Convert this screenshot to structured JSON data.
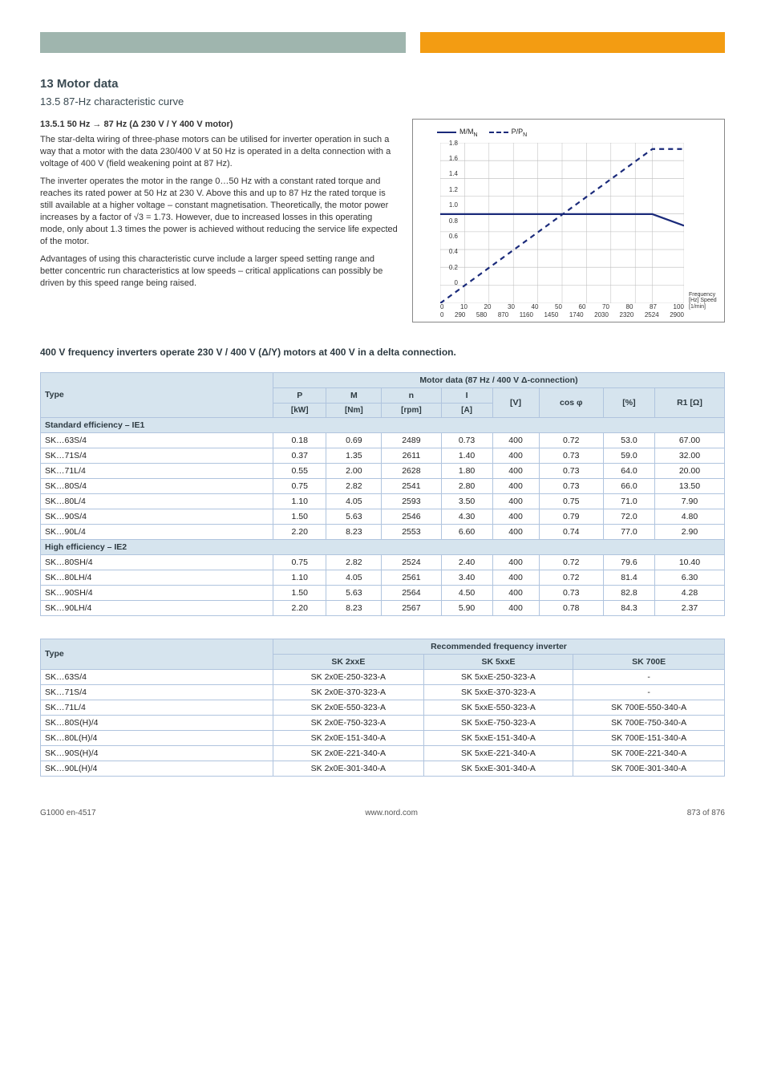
{
  "header": {
    "h1": "13 Motor data",
    "h2": "13.5 87-Hz characteristic curve"
  },
  "intro": {
    "subhead": "13.5.1 50 Hz → 87 Hz (Δ 230 V / Y 400 V motor)",
    "para1": "The star-delta wiring of three-phase motors can be utilised for inverter operation in such a way that a motor with the data 230/400 V at 50 Hz is operated in a delta connection with a voltage of 400 V (field weakening point at 87 Hz).",
    "para2": "The inverter operates the motor in the range 0…50 Hz with a constant rated torque and reaches its rated power at 50 Hz at 230 V. Above this and up to 87 Hz the rated torque is still available at a higher voltage – constant magnetisation. Theoretically, the motor power increases by a factor of √3 = 1.73. However, due to increased losses in this operating mode, only about 1.3 times the power is achieved without reducing the service life expected of the motor.",
    "para3": "Advantages of using this characteristic curve include a larger speed setting range and better concentric run characteristics at low speeds – critical applications can possibly be driven by this speed range being raised.",
    "legend_solid": "M/M",
    "legend_solid_sub": "N",
    "legend_dash": "P/P",
    "legend_dash_sub": "N",
    "axis_note": "Frequency [Hz] Speed [1/min]"
  },
  "chart_data": {
    "type": "line",
    "x_ticks_freq": [
      "0",
      "10",
      "20",
      "30",
      "40",
      "50",
      "60",
      "70",
      "80",
      "87",
      "100"
    ],
    "x_ticks_speed": [
      "0",
      "290",
      "580",
      "870",
      "1160",
      "1450",
      "1740",
      "2030",
      "2320",
      "2524",
      "2900"
    ],
    "y_ticks": [
      "0",
      "0.2",
      "0.4",
      "0.6",
      "0.8",
      "1.0",
      "1.2",
      "1.4",
      "1.6",
      "1.8"
    ],
    "series": [
      {
        "name": "M/M_N",
        "style": "solid",
        "points": [
          [
            0,
            1.0
          ],
          [
            87,
            1.0
          ],
          [
            100,
            0.87
          ]
        ]
      },
      {
        "name": "P/P_N",
        "style": "dash",
        "points": [
          [
            0,
            0.0
          ],
          [
            87,
            1.73
          ],
          [
            100,
            1.73
          ]
        ]
      }
    ],
    "xlim": [
      0,
      100
    ],
    "ylim": [
      0,
      1.8
    ]
  },
  "info_line": "400 V frequency inverters operate 230 V / 400 V (Δ/Y) motors at 400 V in a delta connection.",
  "table1": {
    "super_left": "Type",
    "super_right": "Motor data (87 Hz / 400 V Δ-connection)",
    "cols": [
      "P",
      "M",
      "n",
      "I",
      "[V]",
      "cos φ",
      "[%]",
      "R1 [Ω]"
    ],
    "units": [
      "[kW]",
      "[Nm]",
      "[rpm]",
      "[A]",
      "",
      "",
      "",
      ""
    ],
    "group1_label": "Standard efficiency – IE1",
    "group1_rows": [
      [
        "SK…63S/4",
        "0.18",
        "0.69",
        "2489",
        "0.73",
        "400",
        "0.72",
        "53.0",
        "67.00"
      ],
      [
        "SK…71S/4",
        "0.37",
        "1.35",
        "2611",
        "1.40",
        "400",
        "0.73",
        "59.0",
        "32.00"
      ],
      [
        "SK…71L/4",
        "0.55",
        "2.00",
        "2628",
        "1.80",
        "400",
        "0.73",
        "64.0",
        "20.00"
      ],
      [
        "SK…80S/4",
        "0.75",
        "2.82",
        "2541",
        "2.80",
        "400",
        "0.73",
        "66.0",
        "13.50"
      ],
      [
        "SK…80L/4",
        "1.10",
        "4.05",
        "2593",
        "3.50",
        "400",
        "0.75",
        "71.0",
        "7.90"
      ],
      [
        "SK…90S/4",
        "1.50",
        "5.63",
        "2546",
        "4.30",
        "400",
        "0.79",
        "72.0",
        "4.80"
      ],
      [
        "SK…90L/4",
        "2.20",
        "8.23",
        "2553",
        "6.60",
        "400",
        "0.74",
        "77.0",
        "2.90"
      ]
    ],
    "group2_label": "High efficiency – IE2",
    "group2_rows": [
      [
        "SK…80SH/4",
        "0.75",
        "2.82",
        "2524",
        "2.40",
        "400",
        "0.72",
        "79.6",
        "10.40"
      ],
      [
        "SK…80LH/4",
        "1.10",
        "4.05",
        "2561",
        "3.40",
        "400",
        "0.72",
        "81.4",
        "6.30"
      ],
      [
        "SK…90SH/4",
        "1.50",
        "5.63",
        "2564",
        "4.50",
        "400",
        "0.73",
        "82.8",
        "4.28"
      ],
      [
        "SK…90LH/4",
        "2.20",
        "8.23",
        "2567",
        "5.90",
        "400",
        "0.78",
        "84.3",
        "2.37"
      ]
    ]
  },
  "table2": {
    "super_left": "Type",
    "super_right": "Recommended frequency inverter",
    "cols": [
      "SK 2xxE",
      "SK 5xxE",
      "SK 700E"
    ],
    "rows": [
      [
        "SK…63S/4",
        "SK 2x0E-250-323-A",
        "SK 5xxE-250-323-A",
        "-"
      ],
      [
        "SK…71S/4",
        "SK 2x0E-370-323-A",
        "SK 5xxE-370-323-A",
        "-"
      ],
      [
        "SK…71L/4",
        "SK 2x0E-550-323-A",
        "SK 5xxE-550-323-A",
        "SK 700E-550-340-A"
      ],
      [
        "SK…80S(H)/4",
        "SK 2x0E-750-323-A",
        "SK 5xxE-750-323-A",
        "SK 700E-750-340-A"
      ],
      [
        "SK…80L(H)/4",
        "SK 2x0E-151-340-A",
        "SK 5xxE-151-340-A",
        "SK 700E-151-340-A"
      ],
      [
        "SK…90S(H)/4",
        "SK 2x0E-221-340-A",
        "SK 5xxE-221-340-A",
        "SK 700E-221-340-A"
      ],
      [
        "SK…90L(H)/4",
        "SK 2x0E-301-340-A",
        "SK 5xxE-301-340-A",
        "SK 700E-301-340-A"
      ]
    ]
  },
  "footer": {
    "left": "G1000 en-4517",
    "center": "www.nord.com",
    "right": "873 of 876"
  }
}
